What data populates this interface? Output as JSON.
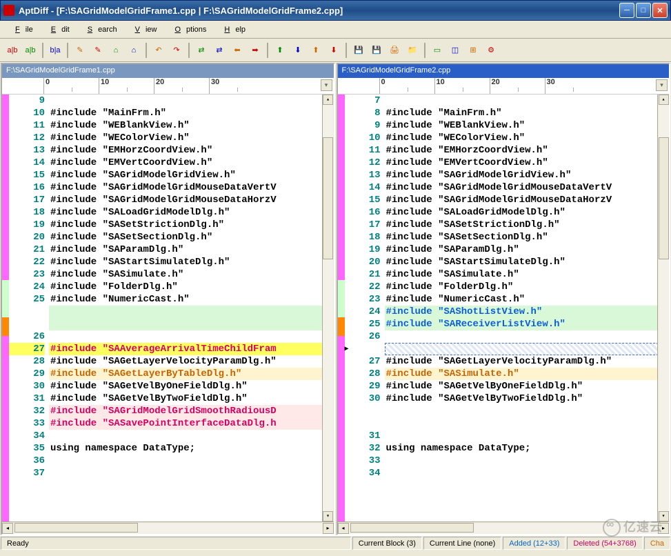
{
  "title": "AptDiff - [F:\\SAGridModelGridFrame1.cpp | F:\\SAGridModelGridFrame2.cpp]",
  "menu": [
    "File",
    "Edit",
    "Search",
    "View",
    "Options",
    "Help"
  ],
  "toolbar_icons": [
    "compare-files",
    "compare-folders",
    "swap",
    "next-diff",
    "prev-diff",
    "first-diff",
    "last-diff",
    "undo",
    "redo",
    "copy-left",
    "copy-right",
    "left-all",
    "right-all",
    "up1",
    "down1",
    "up2",
    "down2",
    "save",
    "save-all",
    "print",
    "folder",
    "view-single",
    "view-split",
    "view-grid",
    "settings"
  ],
  "left": {
    "path": "F:\\SAGridModelGridFrame1.cpp",
    "ruler": [
      "0",
      "10",
      "20",
      "30"
    ],
    "lines": [
      {
        "n": 9,
        "t": "",
        "c": "same"
      },
      {
        "n": 10,
        "t": "#include \"MainFrm.h\"",
        "c": "same"
      },
      {
        "n": 11,
        "t": "#include \"WEBlankView.h\"",
        "c": "same"
      },
      {
        "n": 12,
        "t": "#include \"WEColorView.h\"",
        "c": "same"
      },
      {
        "n": 13,
        "t": "#include \"EMHorzCoordView.h\"",
        "c": "same"
      },
      {
        "n": 14,
        "t": "#include \"EMVertCoordView.h\"",
        "c": "same"
      },
      {
        "n": 15,
        "t": "#include \"SAGridModelGridView.h\"",
        "c": "same"
      },
      {
        "n": 16,
        "t": "#include \"SAGridModelGridMouseDataVertV",
        "c": "same"
      },
      {
        "n": 17,
        "t": "#include \"SAGridModelGridMouseDataHorzV",
        "c": "same"
      },
      {
        "n": 18,
        "t": "#include \"SALoadGridModelDlg.h\"",
        "c": "same"
      },
      {
        "n": 19,
        "t": "#include \"SASetStrictionDlg.h\"",
        "c": "same"
      },
      {
        "n": 20,
        "t": "#include \"SASetSectionDlg.h\"",
        "c": "same"
      },
      {
        "n": 21,
        "t": "#include \"SAParamDlg.h\"",
        "c": "same"
      },
      {
        "n": 22,
        "t": "#include \"SAStartSimulateDlg.h\"",
        "c": "same"
      },
      {
        "n": 23,
        "t": "#include \"SASimulate.h\"",
        "c": "same"
      },
      {
        "n": 24,
        "t": "#include \"FolderDlg.h\"",
        "c": "same"
      },
      {
        "n": 25,
        "t": "#include \"NumericCast.h\"",
        "c": "same"
      },
      {
        "n": "",
        "t": "",
        "c": "added"
      },
      {
        "n": "",
        "t": "",
        "c": "added"
      },
      {
        "n": 26,
        "t": "",
        "c": "same"
      },
      {
        "n": 27,
        "t": "#include \"SAAverageArrivalTimeChildFram",
        "c": "deleted",
        "sel": true
      },
      {
        "n": 28,
        "t": "#include \"SAGetLayerVelocityParamDlg.h\"",
        "c": "same"
      },
      {
        "n": 29,
        "t": "#include \"SAGetLayerByTableDlg.h\"",
        "c": "changed"
      },
      {
        "n": 30,
        "t": "#include \"SAGetVelByOneFieldDlg.h\"",
        "c": "same"
      },
      {
        "n": 31,
        "t": "#include \"SAGetVelByTwoFieldDlg.h\"",
        "c": "same"
      },
      {
        "n": 32,
        "t": "#include \"SAGridModelGridSmoothRadiousD",
        "c": "deleted"
      },
      {
        "n": 33,
        "t": "#include \"SASavePointInterfaceDataDlg.h",
        "c": "deleted"
      },
      {
        "n": 34,
        "t": "",
        "c": "same"
      },
      {
        "n": 35,
        "t": "using namespace DataType;",
        "c": "same"
      },
      {
        "n": 36,
        "t": "",
        "c": "same"
      },
      {
        "n": 37,
        "t": "",
        "c": "same"
      }
    ]
  },
  "right": {
    "path": "F:\\SAGridModelGridFrame2.cpp",
    "ruler": [
      "0",
      "10",
      "20",
      "30"
    ],
    "lines": [
      {
        "n": 7,
        "t": "",
        "c": "same"
      },
      {
        "n": 8,
        "t": "#include \"MainFrm.h\"",
        "c": "same"
      },
      {
        "n": 9,
        "t": "#include \"WEBlankView.h\"",
        "c": "same"
      },
      {
        "n": 10,
        "t": "#include \"WEColorView.h\"",
        "c": "same"
      },
      {
        "n": 11,
        "t": "#include \"EMHorzCoordView.h\"",
        "c": "same"
      },
      {
        "n": 12,
        "t": "#include \"EMVertCoordView.h\"",
        "c": "same"
      },
      {
        "n": 13,
        "t": "#include \"SAGridModelGridView.h\"",
        "c": "same"
      },
      {
        "n": 14,
        "t": "#include \"SAGridModelGridMouseDataVertV",
        "c": "same"
      },
      {
        "n": 15,
        "t": "#include \"SAGridModelGridMouseDataHorzV",
        "c": "same"
      },
      {
        "n": 16,
        "t": "#include \"SALoadGridModelDlg.h\"",
        "c": "same"
      },
      {
        "n": 17,
        "t": "#include \"SASetStrictionDlg.h\"",
        "c": "same"
      },
      {
        "n": 18,
        "t": "#include \"SASetSectionDlg.h\"",
        "c": "same"
      },
      {
        "n": 19,
        "t": "#include \"SAParamDlg.h\"",
        "c": "same"
      },
      {
        "n": 20,
        "t": "#include \"SAStartSimulateDlg.h\"",
        "c": "same"
      },
      {
        "n": 21,
        "t": "#include \"SASimulate.h\"",
        "c": "same"
      },
      {
        "n": 22,
        "t": "#include \"FolderDlg.h\"",
        "c": "same"
      },
      {
        "n": 23,
        "t": "#include \"NumericCast.h\"",
        "c": "same"
      },
      {
        "n": 24,
        "t": "#include \"SAShotListView.h\"",
        "c": "added"
      },
      {
        "n": 25,
        "t": "#include \"SAReceiverListView.h\"",
        "c": "added"
      },
      {
        "n": 26,
        "t": "",
        "c": "same"
      },
      {
        "n": "",
        "t": "",
        "c": "highlight-box",
        "arrow": true
      },
      {
        "n": 27,
        "t": "#include \"SAGetLayerVelocityParamDlg.h\"",
        "c": "same"
      },
      {
        "n": 28,
        "t": "#include \"SASimulate.h\"",
        "c": "changed"
      },
      {
        "n": 29,
        "t": "#include \"SAGetVelByOneFieldDlg.h\"",
        "c": "same"
      },
      {
        "n": 30,
        "t": "#include \"SAGetVelByTwoFieldDlg.h\"",
        "c": "same"
      },
      {
        "n": "",
        "t": "",
        "c": "ghost"
      },
      {
        "n": "",
        "t": "",
        "c": "ghost"
      },
      {
        "n": 31,
        "t": "",
        "c": "same"
      },
      {
        "n": 32,
        "t": "using namespace DataType;",
        "c": "same"
      },
      {
        "n": 33,
        "t": "",
        "c": "same"
      },
      {
        "n": 34,
        "t": "",
        "c": "same"
      }
    ]
  },
  "status": {
    "ready": "Ready",
    "block": "Current Block (3)",
    "line": "Current Line (none)",
    "added": "Added (12+33)",
    "deleted": "Deleted (54+3768)",
    "changed": "Cha"
  },
  "watermark": "亿速云"
}
